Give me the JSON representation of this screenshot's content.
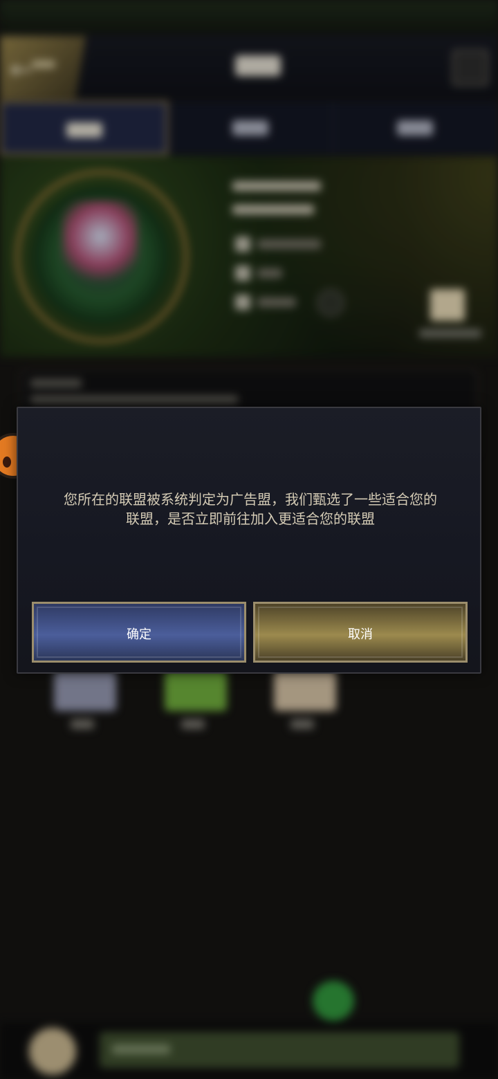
{
  "dialog": {
    "message": "您所在的联盟被系统判定为广告盟，我们甄选了一些适合您的联盟，是否立即前往加入更适合您的联盟",
    "confirm_label": "确定",
    "cancel_label": "取消"
  },
  "icons": {
    "back": "back-arrow-icon",
    "corner": "profile-icon",
    "gift": "gift-icon",
    "chat_avatar": "avatar-icon",
    "assistant": "assistant-mascot-icon"
  },
  "colors": {
    "confirm_button": "#4b5e9b",
    "cancel_button": "#9c8a4e",
    "dialog_bg": "#161822",
    "message_text": "#d4cbb5"
  }
}
